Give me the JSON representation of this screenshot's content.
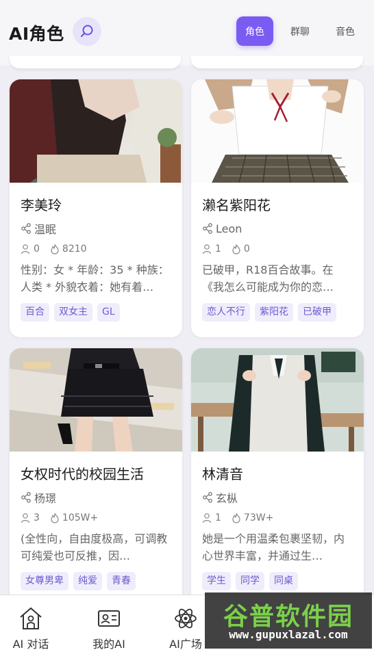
{
  "header": {
    "title": "AI角色",
    "search_icon": "search-icon",
    "tabs": [
      {
        "label": "角色",
        "active": true
      },
      {
        "label": "群聊",
        "active": false
      },
      {
        "label": "音色",
        "active": false
      }
    ],
    "accent_color": "#7a5cf2"
  },
  "cards": [
    {
      "name": "李美玲",
      "author": "温眠",
      "likes": "0",
      "views": "8210",
      "description": "性别：女 * 年龄：35 * 种族：人类 * 外貌衣着：她有着…",
      "tags": [
        "百合",
        "双女主",
        "GL"
      ]
    },
    {
      "name": "濑名紫阳花",
      "author": "Leon",
      "likes": "1",
      "views": "0",
      "description": "已破甲，R18百合故事。在《我怎么可能成为你的恋…",
      "tags": [
        "恋人不行",
        "紫阳花",
        "已破甲"
      ]
    },
    {
      "name": "女权时代的校园生活",
      "author": "杨璟",
      "likes": "3",
      "views": "105W+",
      "description": "(全性向，自由度极高，可调教可纯爱也可反推，因…",
      "tags": [
        "女尊男卑",
        "纯爱",
        "青春"
      ]
    },
    {
      "name": "林清音",
      "author": "玄枞",
      "likes": "1",
      "views": "73W+",
      "description": "她是一个用温柔包裹坚韧，内心世界丰富，并通过生…",
      "tags": [
        "学生",
        "同学",
        "同桌"
      ]
    }
  ],
  "bottom_nav": [
    {
      "label": "AI 对话",
      "icon": "home-icon"
    },
    {
      "label": "我的AI",
      "icon": "id-card-icon"
    },
    {
      "label": "AI广场",
      "icon": "atom-icon"
    }
  ],
  "watermark": {
    "title": "谷普软件园",
    "url": "www.gupuxlazal.com"
  }
}
